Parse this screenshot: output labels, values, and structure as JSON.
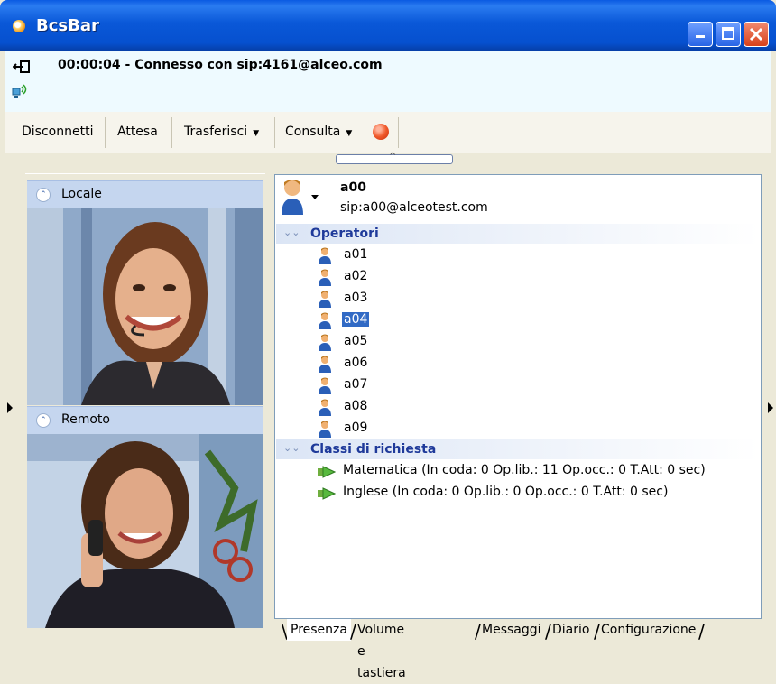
{
  "window": {
    "title": "BcsBar",
    "controls": {
      "minimize": "minimize-icon",
      "maximize": "maximize-icon",
      "close": "close-icon"
    }
  },
  "status": {
    "text": "00:00:04 - Connesso con sip:4161@alceo.com"
  },
  "toolbar": {
    "disconnect": "Disconnetti",
    "hold": "Attesa",
    "transfer": "Trasferisci",
    "consult": "Consulta"
  },
  "video": {
    "local_label": "Locale",
    "remote_label": "Remoto"
  },
  "user": {
    "name": "a00",
    "sip": "sip:a00@alceotest.com"
  },
  "operators": {
    "header": "Operatori",
    "items": [
      "a01",
      "a02",
      "a03",
      "a04",
      "a05",
      "a06",
      "a07",
      "a08",
      "a09"
    ],
    "selected": "a04"
  },
  "request_classes": {
    "header": "Classi di richiesta",
    "items": [
      "Matematica (In coda: 0  Op.lib.: 11  Op.occ.: 0  T.Att: 0 sec)",
      "Inglese (In coda: 0  Op.lib.: 0  Op.occ.: 0  T.Att: 0 sec)"
    ]
  },
  "tabs": [
    "Presenza",
    "Volume e tastiera",
    "Messaggi",
    "Diario",
    "Configurazione"
  ],
  "colors": {
    "titlebar": "#0a58d8",
    "selection": "#316ac5",
    "group_header_text": "#1f3a9a"
  }
}
